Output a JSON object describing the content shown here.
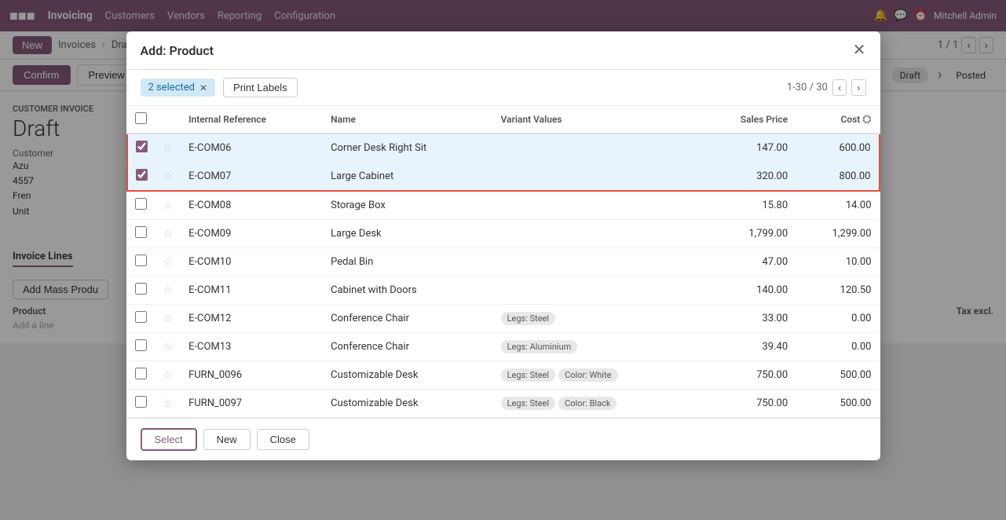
{
  "app": {
    "brand": "Invoicing",
    "nav_links": [
      "Customers",
      "Vendors",
      "Reporting",
      "Configuration"
    ],
    "user": "Mitchell Admin"
  },
  "breadcrumb": {
    "new_label": "New",
    "invoices_label": "Invoices",
    "draft_label": "Draft Invoice (",
    "pagination": "1 / 1"
  },
  "actions": {
    "confirm_label": "Confirm",
    "preview_label": "Preview",
    "status_draft": "Draft",
    "status_posted": "Posted"
  },
  "invoice": {
    "type": "Customer Invoice",
    "status": "Draft",
    "customer_label": "Customer",
    "customer_name": "Azu",
    "customer_address": "4557",
    "customer_country": "Fren",
    "customer_unit": "Unit"
  },
  "modal": {
    "title": "Add: Product",
    "selected_badge": "2 selected",
    "print_labels": "Print Labels",
    "pagination": "1-30 / 30",
    "columns": {
      "internal_ref": "Internal Reference",
      "name": "Name",
      "variant_values": "Variant Values",
      "sales_price": "Sales Price",
      "cost": "Cost"
    },
    "rows": [
      {
        "id": "E-COM06",
        "name": "Corner Desk Right Sit",
        "variants": [],
        "sales_price": "147.00",
        "cost": "600.00",
        "selected": true
      },
      {
        "id": "E-COM07",
        "name": "Large Cabinet",
        "variants": [],
        "sales_price": "320.00",
        "cost": "800.00",
        "selected": true
      },
      {
        "id": "E-COM08",
        "name": "Storage Box",
        "variants": [],
        "sales_price": "15.80",
        "cost": "14.00",
        "selected": false
      },
      {
        "id": "E-COM09",
        "name": "Large Desk",
        "variants": [],
        "sales_price": "1,799.00",
        "cost": "1,299.00",
        "selected": false
      },
      {
        "id": "E-COM10",
        "name": "Pedal Bin",
        "variants": [],
        "sales_price": "47.00",
        "cost": "10.00",
        "selected": false
      },
      {
        "id": "E-COM11",
        "name": "Cabinet with Doors",
        "variants": [],
        "sales_price": "140.00",
        "cost": "120.50",
        "selected": false
      },
      {
        "id": "E-COM12",
        "name": "Conference Chair",
        "variants": [
          "Legs: Steel"
        ],
        "sales_price": "33.00",
        "cost": "0.00",
        "selected": false
      },
      {
        "id": "E-COM13",
        "name": "Conference Chair",
        "variants": [
          "Legs: Aluminium"
        ],
        "sales_price": "39.40",
        "cost": "0.00",
        "selected": false
      },
      {
        "id": "FURN_0096",
        "name": "Customizable Desk",
        "variants": [
          "Legs: Steel",
          "Color: White"
        ],
        "sales_price": "750.00",
        "cost": "500.00",
        "selected": false
      },
      {
        "id": "FURN_0097",
        "name": "Customizable Desk",
        "variants": [
          "Legs: Steel",
          "Color: Black"
        ],
        "sales_price": "750.00",
        "cost": "500.00",
        "selected": false
      }
    ],
    "footer": {
      "select_label": "Select",
      "new_label": "New",
      "close_label": "Close"
    }
  },
  "invoice_lines": {
    "label": "Invoice Lines",
    "add_mass_label": "Add Mass Produ",
    "product_col": "Product",
    "tax_excl": "Tax excl.",
    "add_line": "Add a line"
  }
}
